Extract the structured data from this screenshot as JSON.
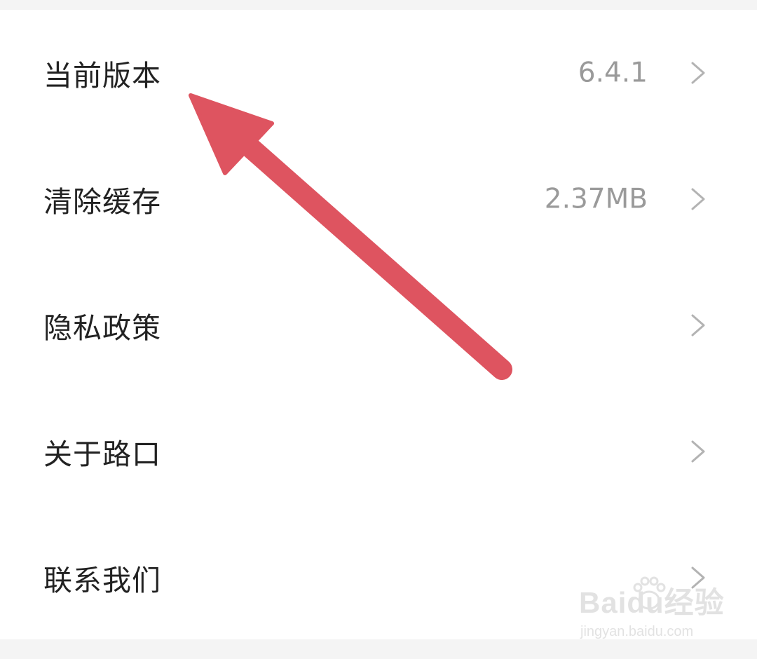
{
  "settings": {
    "rows": [
      {
        "label": "当前版本",
        "value": "6.4.1"
      },
      {
        "label": "清除缓存",
        "value": "2.37MB"
      },
      {
        "label": "隐私政策",
        "value": ""
      },
      {
        "label": "关于路口",
        "value": ""
      },
      {
        "label": "联系我们",
        "value": ""
      }
    ]
  },
  "annotation": {
    "arrow_color": "#de5460",
    "points_to": "当前版本"
  },
  "watermark": {
    "brand": "Baidu经验",
    "url": "jingyan.baidu.com"
  },
  "icons": {
    "row_chevron": "chevron-right-icon"
  },
  "colors": {
    "background": "#f4f4f4",
    "panel": "#ffffff",
    "label_text": "#222222",
    "value_text": "#9a9a9a",
    "chevron": "#b3b3b3"
  }
}
